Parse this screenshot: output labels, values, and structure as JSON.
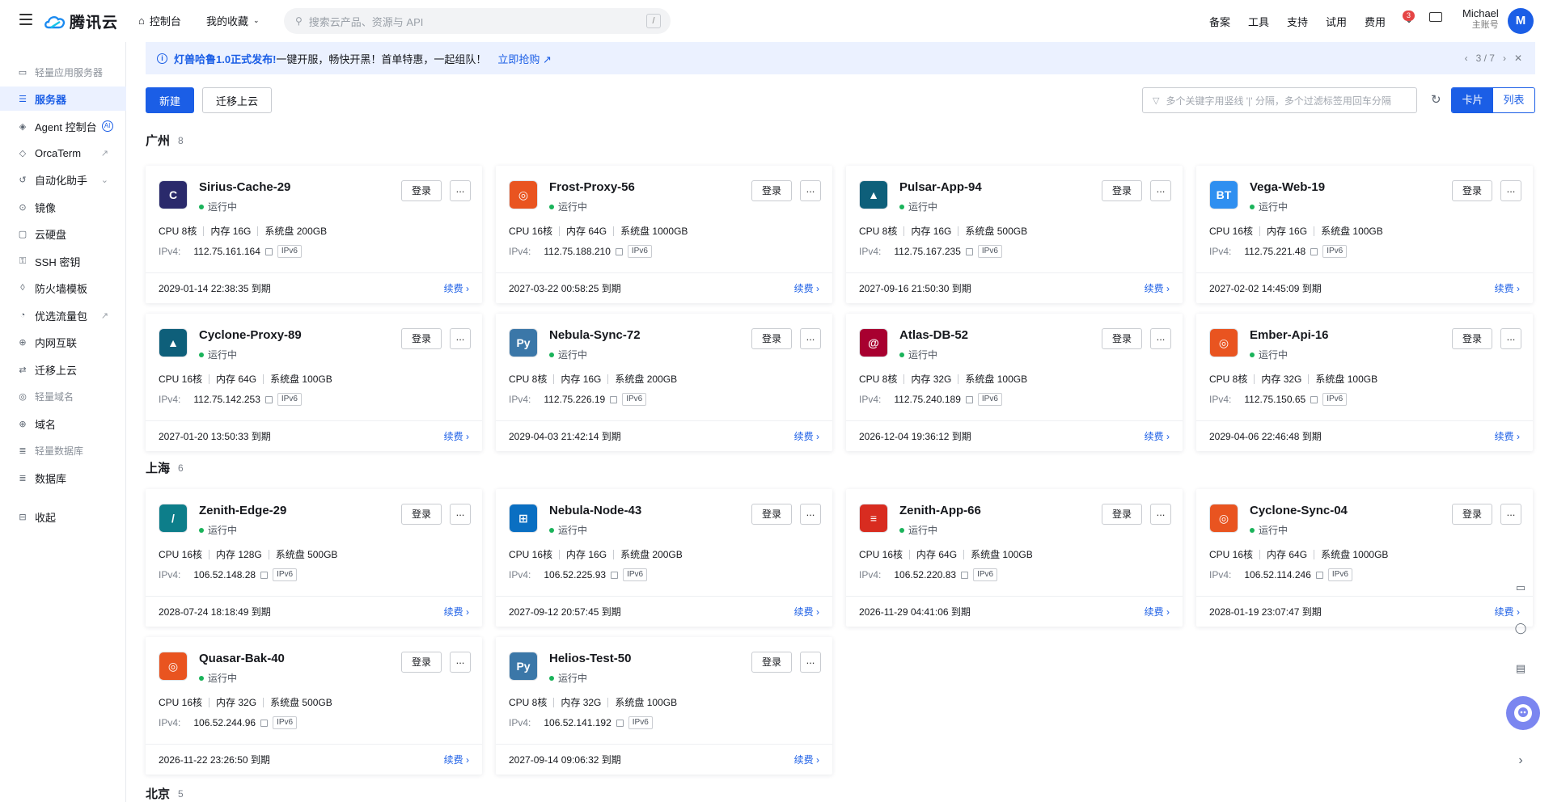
{
  "topbar": {
    "brand": "腾讯云",
    "console": "控制台",
    "favorites": "我的收藏",
    "search_placeholder": "搜索云产品、资源与 API",
    "search_shortcut": "/",
    "right_links": [
      "备案",
      "工具",
      "支持",
      "试用",
      "费用"
    ],
    "notification_count": "3",
    "user_name": "Michael",
    "user_role": "主账号",
    "avatar_letter": "M"
  },
  "sidebar": {
    "items": [
      {
        "label": "轻量应用服务器",
        "type": "group",
        "icon": "server-group-icon"
      },
      {
        "label": "服务器",
        "type": "item",
        "active": true,
        "icon": "server-list-icon"
      },
      {
        "label": "Agent 控制台",
        "type": "item",
        "icon": "agent-icon",
        "badge": "AI"
      },
      {
        "label": "OrcaTerm",
        "type": "item",
        "icon": "terminal-icon",
        "external": true
      },
      {
        "label": "自动化助手",
        "type": "item",
        "icon": "automation-icon",
        "expand": true
      },
      {
        "label": "镜像",
        "type": "item",
        "icon": "image-icon"
      },
      {
        "label": "云硬盘",
        "type": "item",
        "icon": "disk-icon"
      },
      {
        "label": "SSH 密钥",
        "type": "item",
        "icon": "key-icon"
      },
      {
        "label": "防火墙模板",
        "type": "item",
        "icon": "firewall-icon"
      },
      {
        "label": "优选流量包",
        "type": "item",
        "icon": "traffic-icon",
        "external": true
      },
      {
        "label": "内网互联",
        "type": "item",
        "icon": "network-icon"
      },
      {
        "label": "迁移上云",
        "type": "item",
        "icon": "migrate-icon"
      },
      {
        "label": "轻量域名",
        "type": "group",
        "icon": "domain-group-icon"
      },
      {
        "label": "域名",
        "type": "item",
        "icon": "globe-icon"
      },
      {
        "label": "轻量数据库",
        "type": "group",
        "icon": "db-group-icon"
      },
      {
        "label": "数据库",
        "type": "item",
        "icon": "database-icon"
      },
      {
        "label": "收起",
        "type": "item",
        "icon": "collapse-icon"
      }
    ]
  },
  "notice": {
    "highlight": "灯兽哈鲁1.0正式发布!",
    "text": "一键开服，畅快开黑！首单特惠，一起组队！",
    "link": "立即抢购 ↗",
    "pager": "3 / 7"
  },
  "toolbar": {
    "new_label": "新建",
    "migrate_label": "迁移上云",
    "filter_placeholder": "多个关键字用竖线 '|' 分隔，多个过滤标签用回车分隔",
    "view_card": "卡片",
    "view_list": "列表"
  },
  "labels": {
    "status": "运行中",
    "login": "登录",
    "more": "...",
    "ipv4": "IPv4:",
    "ipv6": "IPv6",
    "renew": "续费 ›",
    "expire_suffix": " 到期"
  },
  "regions": [
    {
      "name": "广州",
      "count": "8",
      "servers": [
        {
          "name": "Sirius-Cache-29",
          "cpu": "CPU 8核",
          "mem": "内存 16G",
          "disk": "系统盘 200GB",
          "ip": "112.75.161.164",
          "expire": "2029-01-14 22:38:35",
          "icon": "centos-icon",
          "color": "#2a2a6b",
          "glyph": "C"
        },
        {
          "name": "Frost-Proxy-56",
          "cpu": "CPU 16核",
          "mem": "内存 64G",
          "disk": "系统盘 1000GB",
          "ip": "112.75.188.210",
          "expire": "2027-03-22 00:58:25",
          "icon": "ubuntu-icon",
          "color": "#e95420",
          "glyph": "◎"
        },
        {
          "name": "Pulsar-App-94",
          "cpu": "CPU 8核",
          "mem": "内存 16G",
          "disk": "系统盘 500GB",
          "ip": "112.75.167.235",
          "expire": "2027-09-16 21:50:30",
          "icon": "alma-icon",
          "color": "#0e5f7a",
          "glyph": "▲"
        },
        {
          "name": "Vega-Web-19",
          "cpu": "CPU 16核",
          "mem": "内存 16G",
          "disk": "系统盘 100GB",
          "ip": "112.75.221.48",
          "expire": "2027-02-02 14:45:09",
          "icon": "bt-panel-icon",
          "color": "#2f8ff0",
          "glyph": "BT"
        }
      ]
    },
    {
      "name": "",
      "count": "",
      "servers": [
        {
          "name": "Cyclone-Proxy-89",
          "cpu": "CPU 16核",
          "mem": "内存 64G",
          "disk": "系统盘 100GB",
          "ip": "112.75.142.253",
          "expire": "2027-01-20 13:50:33",
          "icon": "alma-icon",
          "color": "#0e5f7a",
          "glyph": "▲"
        },
        {
          "name": "Nebula-Sync-72",
          "cpu": "CPU 8核",
          "mem": "内存 16G",
          "disk": "系统盘 200GB",
          "ip": "112.75.226.19",
          "expire": "2029-04-03 21:42:14",
          "icon": "python-icon",
          "color": "#3b77a8",
          "glyph": "Py"
        },
        {
          "name": "Atlas-DB-52",
          "cpu": "CPU 8核",
          "mem": "内存 32G",
          "disk": "系统盘 100GB",
          "ip": "112.75.240.189",
          "expire": "2026-12-04 19:36:12",
          "icon": "debian-icon",
          "color": "#a80030",
          "glyph": "@"
        },
        {
          "name": "Ember-Api-16",
          "cpu": "CPU 8核",
          "mem": "内存 32G",
          "disk": "系统盘 100GB",
          "ip": "112.75.150.65",
          "expire": "2029-04-06 22:46:48",
          "icon": "ubuntu-icon",
          "color": "#e95420",
          "glyph": "◎"
        }
      ]
    },
    {
      "name": "上海",
      "count": "6",
      "servers": [
        {
          "name": "Zenith-Edge-29",
          "cpu": "CPU 16核",
          "mem": "内存 128G",
          "disk": "系统盘 500GB",
          "ip": "106.52.148.28",
          "expire": "2028-07-24 18:18:49",
          "icon": "opencloudos-icon",
          "color": "#0d7e8a",
          "glyph": "/"
        },
        {
          "name": "Nebula-Node-43",
          "cpu": "CPU 16核",
          "mem": "内存 16G",
          "disk": "系统盘 200GB",
          "ip": "106.52.225.93",
          "expire": "2027-09-12 20:57:45",
          "icon": "windows-icon",
          "color": "#0a6fc2",
          "glyph": "⊞"
        },
        {
          "name": "Zenith-App-66",
          "cpu": "CPU 16核",
          "mem": "内存 64G",
          "disk": "系统盘 100GB",
          "ip": "106.52.220.83",
          "expire": "2026-11-29 04:41:06",
          "icon": "redis-icon",
          "color": "#d82c20",
          "glyph": "≡"
        },
        {
          "name": "Cyclone-Sync-04",
          "cpu": "CPU 16核",
          "mem": "内存 64G",
          "disk": "系统盘 1000GB",
          "ip": "106.52.114.246",
          "expire": "2028-01-19 23:07:47",
          "icon": "ubuntu-icon",
          "color": "#e95420",
          "glyph": "◎"
        }
      ]
    },
    {
      "name": "",
      "count": "",
      "servers": [
        {
          "name": "Quasar-Bak-40",
          "cpu": "CPU 16核",
          "mem": "内存 32G",
          "disk": "系统盘 500GB",
          "ip": "106.52.244.96",
          "expire": "2026-11-22 23:26:50",
          "icon": "ubuntu-icon",
          "color": "#e95420",
          "glyph": "◎"
        },
        {
          "name": "Helios-Test-50",
          "cpu": "CPU 8核",
          "mem": "内存 32G",
          "disk": "系统盘 100GB",
          "ip": "106.52.141.192",
          "expire": "2027-09-14 09:06:32",
          "icon": "python-icon",
          "color": "#3b77a8",
          "glyph": "Py"
        }
      ]
    }
  ],
  "region_beijing": {
    "name": "北京",
    "count": "5"
  }
}
